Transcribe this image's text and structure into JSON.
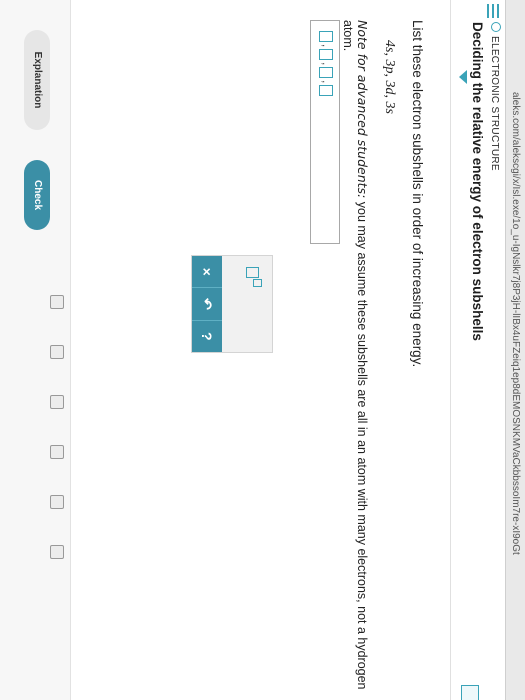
{
  "browser": {
    "url": "aleks.com/alekscgi/x/Isl.exe/1o_u-IgNslkr7j8P3jH-lIBx4uFZeiq1ep8dEMOSNKMVaCkbbssoIm7re-xI9oGt"
  },
  "header": {
    "topic": "ELECTRONIC STRUCTURE",
    "title": "Deciding the relative energy of electron subshells"
  },
  "question": {
    "instruction": "List these electron subshells in order of increasing energy.",
    "subshells": "4s, 3p, 3d, 3s",
    "note_label": "Note for advanced students:",
    "note_text": " you may assume these subshells are all in an atom with many electrons, not a hydrogen atom."
  },
  "answer": {
    "separators": [
      ",",
      ",",
      ","
    ]
  },
  "palette": {
    "clear_label": "×",
    "undo_label": "↶",
    "help_label": "?"
  },
  "footer": {
    "explanation_label": "Explanation",
    "check_label": "Check"
  },
  "colors": {
    "accent": "#3b8fa6",
    "outline": "#3aa3b8"
  },
  "icons": [
    "menu-icon",
    "topic-circle-icon",
    "collapse-caret-icon",
    "superscript-template-icon",
    "clear-icon",
    "undo-icon",
    "help-icon"
  ]
}
